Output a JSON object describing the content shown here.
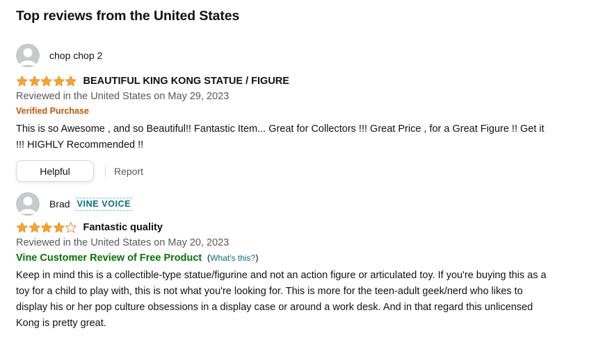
{
  "section": {
    "title": "Top reviews from the United States"
  },
  "reviews": [
    {
      "author": "chop chop 2",
      "rating": 5,
      "title": "BEAUTIFUL KING KONG STATUE / FIGURE",
      "date": "Reviewed in the United States on May 29, 2023",
      "verified": "Verified Purchase",
      "body": "This is so Awesome , and so Beautiful!! Fantastic Item... Great for Collectors !!! Great Price , for a Great Figure !! Get it !!! HIGHLY Recommended !!",
      "helpful_label": "Helpful",
      "report_label": "Report"
    },
    {
      "author": "Brad",
      "badge": "VINE VOICE",
      "rating": 4,
      "title": "Fantastic quality",
      "date": "Reviewed in the United States on May 20, 2023",
      "vine_label": "Vine Customer Review of Free Product",
      "whats_this": "What's this?",
      "body": "Keep in mind this is a collectible-type statue/figurine and not an action figure or articulated toy. If you're buying this as a toy for a child to play with, this is not what you're looking for. This is more for the teen-adult geek/nerd who likes to display his or her pop culture obsessions in a display case or around a work desk. And in that regard this unlicensed Kong is pretty great."
    }
  ],
  "icons": {
    "avatar": "default-profile-avatar-icon",
    "star_full": "star-filled-icon",
    "star_empty": "star-outline-icon"
  },
  "colors": {
    "star": "#ffa41c",
    "verified": "#c45500",
    "vine": "#007600",
    "link": "#007185",
    "secondary_text": "#565959"
  }
}
